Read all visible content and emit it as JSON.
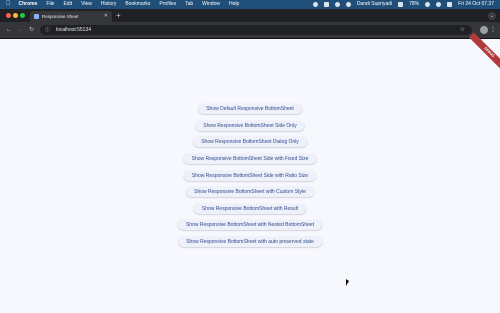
{
  "menubar": {
    "app_name": "Chrome",
    "items": [
      "File",
      "Edit",
      "View",
      "History",
      "Bookmarks",
      "Profiles",
      "Tab",
      "Window",
      "Help"
    ],
    "battery": "78%",
    "user": "Dandi Supriyadi",
    "datetime": "Fri 24 Oct  07.37"
  },
  "browser": {
    "tab_title": "Responsive Sheet",
    "url": "localhost:55134"
  },
  "page": {
    "debug_banner": "DEBUG",
    "buttons": [
      "Show Default Responsive BottomSheet",
      "Show Responsive BottomSheet Side Only",
      "Show Responsive BottomSheet Dialog Only",
      "Show Responsive BottomSheet Side with Fixed Size",
      "Show Responsive BottomSheet Side with Ratio Size",
      "Show Responsive BottomSheet with Custom Style",
      "Show Responsive BottomSheet with Result",
      "Show Responsive BottomSheet with Nested BottomSheet",
      "Show Responsive BottomSheet with auto preserved state"
    ]
  },
  "colors": {
    "menubar": "#1f4f79",
    "tabstrip": "#202124",
    "toolbar": "#35363a",
    "page_bg": "#f7f8fd",
    "button_bg": "#eef0fa",
    "button_text": "#2f4b8a",
    "debug_banner": "#b13b3b"
  }
}
